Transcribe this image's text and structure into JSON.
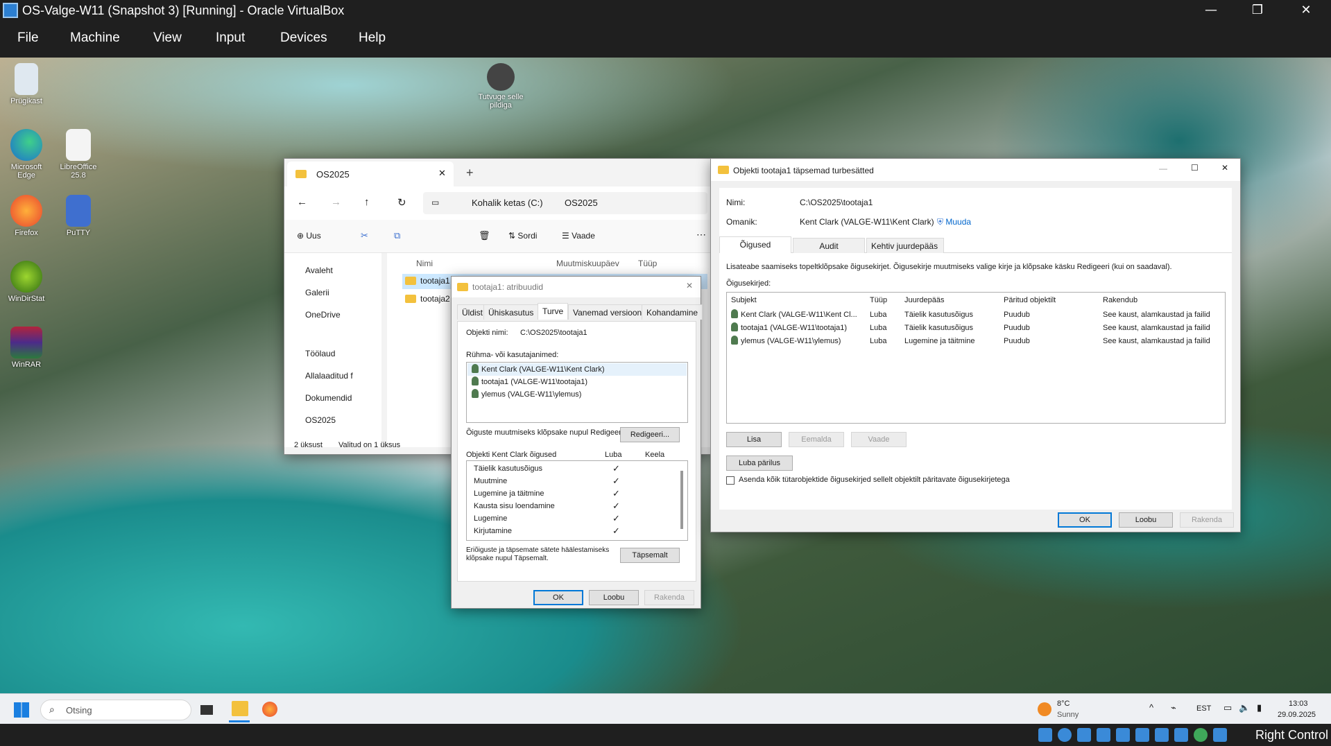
{
  "host": {
    "title": "OS-Valge-W11 (Snapshot 3) [Running] - Oracle VirtualBox",
    "menu": [
      "File",
      "Machine",
      "View",
      "Input",
      "Devices",
      "Help"
    ],
    "right_control": "Right Control"
  },
  "desktop": {
    "icons": [
      "Prügikast",
      "Microsoft Edge",
      "LibreOffice 25.8",
      "Firefox",
      "PuTTY",
      "WinDirStat",
      "WinRAR",
      "Tutvuge selle pildiga"
    ]
  },
  "explorer": {
    "tab": "OS2025",
    "breadcrumb": [
      "Kohalik ketas (C:)",
      "OS2025"
    ],
    "toolbar": {
      "new": "Uus",
      "sort": "Sordi",
      "view": "Vaade"
    },
    "nav": [
      "Avaleht",
      "Galerii",
      "OneDrive",
      "Töölaud",
      "Allalaaditud f",
      "Dokumendid",
      "OS2025"
    ],
    "columns": [
      "Nimi",
      "Muutmiskuupäev",
      "Tüüp"
    ],
    "files": [
      "tootaja1",
      "tootaja2"
    ],
    "status": [
      "2 üksust",
      "Valitud on 1 üksus"
    ]
  },
  "props": {
    "title": "tootaja1: atribuudid",
    "tabs": [
      "Üldist",
      "Ühiskasutus",
      "Turve",
      "Vanemad versioonid",
      "Kohandamine"
    ],
    "object_label": "Objekti nimi:",
    "object_value": "C:\\OS2025\\tootaja1",
    "groups_label": "Rühma- või kasutajanimed:",
    "users": [
      "Kent Clark (VALGE-W11\\Kent Clark)",
      "tootaja1 (VALGE-W11\\tootaja1)",
      "ylemus (VALGE-W11\\ylemus)"
    ],
    "edit_hint": "Õiguste muutmiseks klõpsake nupul Redigeeri.",
    "edit_btn": "Redigeeri...",
    "perm_header": "Objekti Kent Clark õigused",
    "allow": "Luba",
    "deny": "Keela",
    "perms": [
      "Täielik kasutusõigus",
      "Muutmine",
      "Lugemine ja täitmine",
      "Kausta sisu loendamine",
      "Lugemine",
      "Kirjutamine"
    ],
    "check": "✓",
    "adv_hint": "Eriõiguste ja täpsemate sätete häälestamiseks klõpsake nupul Täpsemalt.",
    "adv_btn": "Täpsemalt",
    "ok": "OK",
    "cancel": "Loobu",
    "apply": "Rakenda"
  },
  "adv": {
    "title": "Objekti tootaja1 täpsemad turbesätted",
    "name_label": "Nimi:",
    "name_value": "C:\\OS2025\\tootaja1",
    "owner_label": "Omanik:",
    "owner_value": "Kent Clark (VALGE-W11\\Kent Clark)",
    "change": "Muuda",
    "tabs": [
      "Õigused",
      "Audit",
      "Kehtiv juurdepääs"
    ],
    "info": "Lisateabe saamiseks topeltklõpsake õigusekirjet. Õigusekirje muutmiseks valige kirje ja klõpsake käsku Redigeeri (kui on saadaval).",
    "entries_label": "Õigusekirjed:",
    "columns": [
      "Subjekt",
      "Tüüp",
      "Juurdepääs",
      "Päritud objektilt",
      "Rakendub"
    ],
    "rows": [
      {
        "subject": "Kent Clark (VALGE-W11\\Kent Cl...",
        "type": "Luba",
        "access": "Täielik kasutusõigus",
        "inherited": "Puudub",
        "applies": "See kaust, alamkaustad ja failid"
      },
      {
        "subject": "tootaja1 (VALGE-W11\\tootaja1)",
        "type": "Luba",
        "access": "Täielik kasutusõigus",
        "inherited": "Puudub",
        "applies": "See kaust, alamkaustad ja failid"
      },
      {
        "subject": "ylemus (VALGE-W11\\ylemus)",
        "type": "Luba",
        "access": "Lugemine ja täitmine",
        "inherited": "Puudub",
        "applies": "See kaust, alamkaustad ja failid"
      }
    ],
    "add": "Lisa",
    "remove": "Eemalda",
    "view": "Vaade",
    "inherit": "Luba pärilus",
    "replace": "Asenda kõik tütarobjektide õigusekirjed sellelt objektilt päritavate õigusekirjetega",
    "ok": "OK",
    "cancel": "Loobu",
    "apply": "Rakenda"
  },
  "taskbar": {
    "search": "Otsing",
    "temp": "8°C",
    "weather": "Sunny",
    "lang": "EST",
    "time": "13:03",
    "date": "29.09.2025"
  }
}
